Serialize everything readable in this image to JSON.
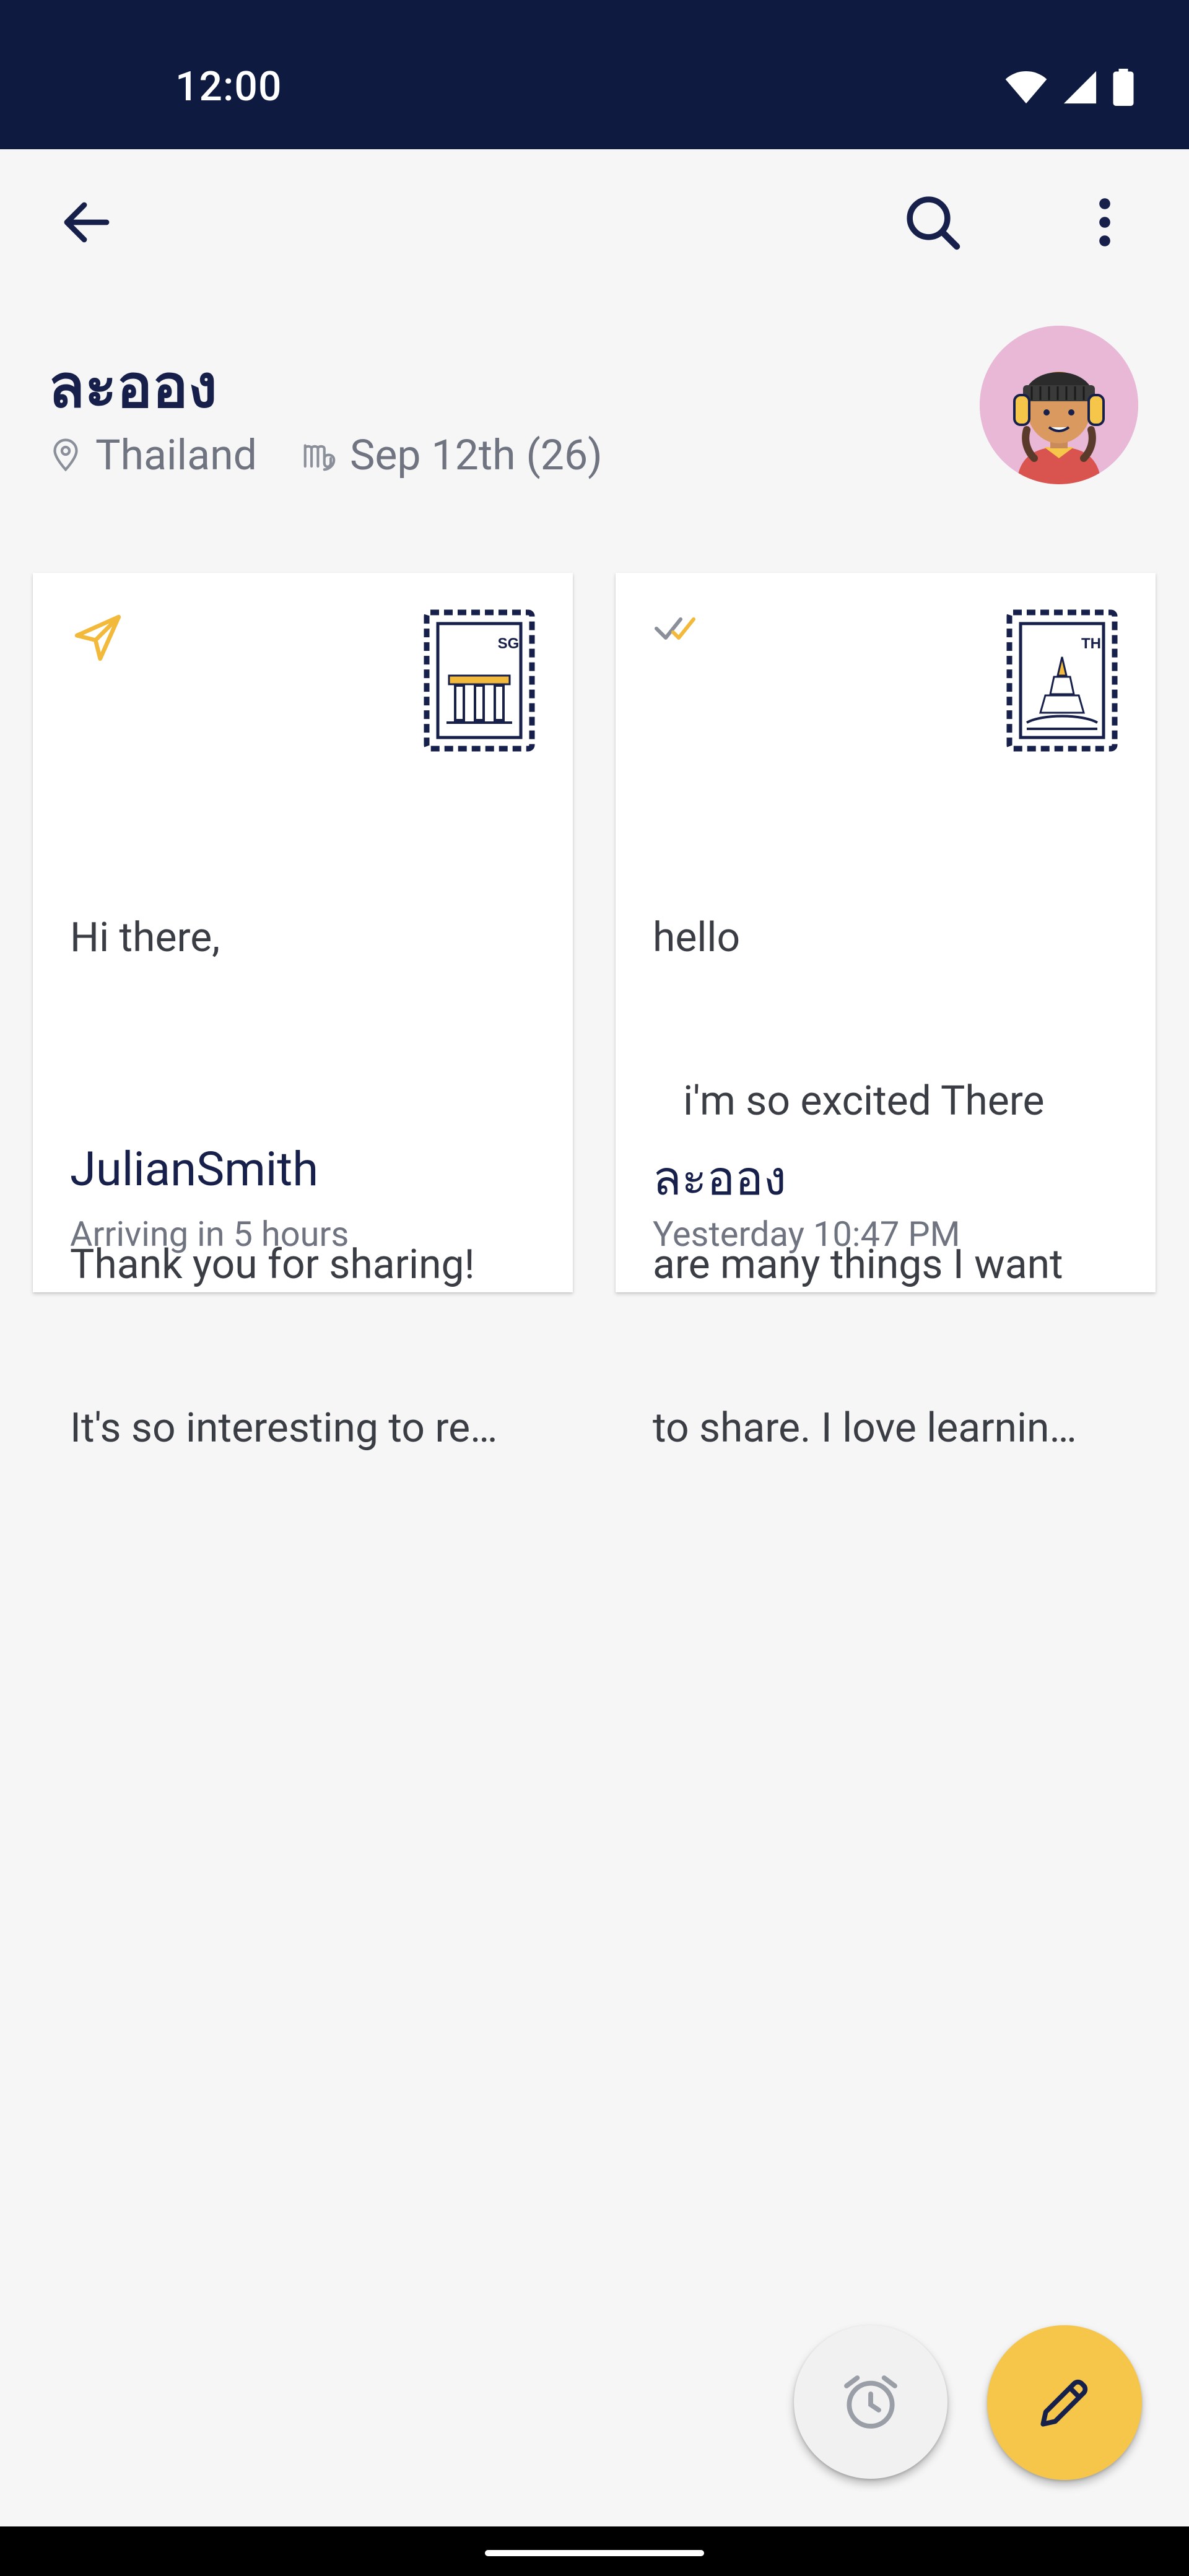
{
  "status_bar": {
    "time": "12:00"
  },
  "profile": {
    "name": "ละออง",
    "location": "Thailand",
    "birthday": "Sep 12th (26)"
  },
  "letters": [
    {
      "status": "sent-in-transit",
      "stamp_code": "SG",
      "body_lines": [
        "Hi there,",
        "",
        "Thank you for sharing!",
        "It's so interesting to re…"
      ],
      "author": "JulianSmith",
      "subtitle": "Arriving in 5 hours"
    },
    {
      "status": "read",
      "stamp_code": "TH",
      "body_lines": [
        "hello",
        "   i'm so excited There",
        "are many things I want",
        "to share. I love learnin…"
      ],
      "author": "ละออง",
      "subtitle": "Yesterday 10:47 PM"
    }
  ],
  "colors": {
    "status_bar": "#0e1a3f",
    "accent": "#f6c64a",
    "text_dark": "#16204a",
    "text_muted": "#6f7480",
    "avatar_bg": "#e8b8d6"
  },
  "icons": {
    "back": "arrow-left-icon",
    "search": "search-icon",
    "more": "more-vert-icon",
    "location": "location-pin-icon",
    "zodiac": "virgo-icon",
    "sent": "paper-plane-icon",
    "read": "double-check-icon",
    "schedule": "alarm-clock-icon",
    "compose": "pencil-icon"
  }
}
